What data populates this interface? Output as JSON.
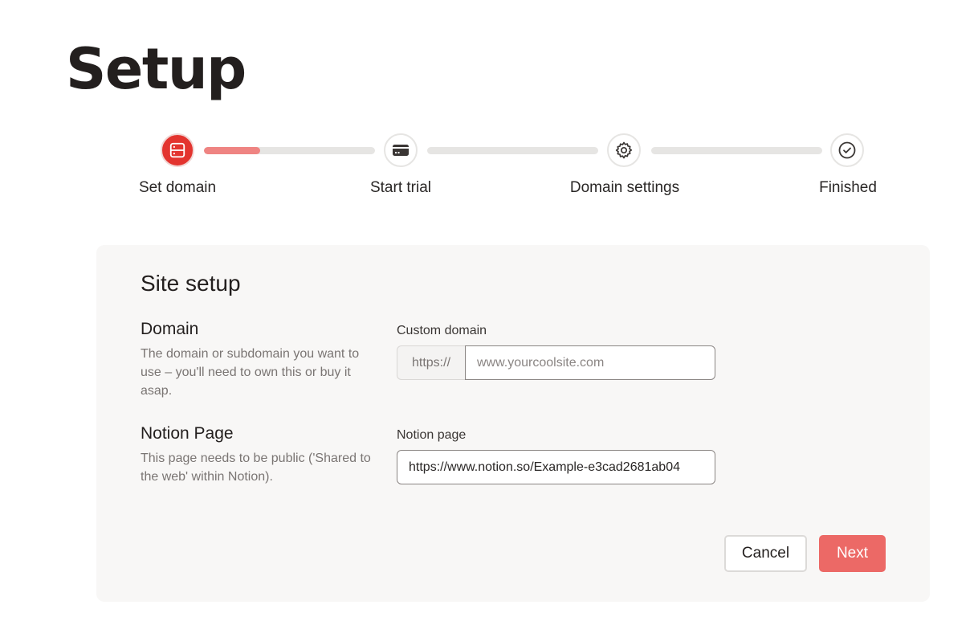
{
  "page": {
    "title": "Setup"
  },
  "stepper": {
    "steps": [
      {
        "label": "Set domain",
        "icon": "server-icon",
        "state": "active"
      },
      {
        "label": "Start trial",
        "icon": "credit-card-icon",
        "state": "pending"
      },
      {
        "label": "Domain settings",
        "icon": "gear-icon",
        "state": "pending"
      },
      {
        "label": "Finished",
        "icon": "check-circle-icon",
        "state": "pending"
      }
    ],
    "connector_progress": [
      0.33,
      0,
      0
    ],
    "colors": {
      "active": "#e3342f",
      "progress": "#ef8482",
      "track": "#e6e5e3"
    }
  },
  "card": {
    "title": "Site setup",
    "domain": {
      "heading": "Domain",
      "description": "The domain or subdomain you want to use – you'll need to own this or buy it asap.",
      "field_label": "Custom domain",
      "prefix": "https://",
      "value": "",
      "placeholder": "www.yourcoolsite.com"
    },
    "notion": {
      "heading": "Notion Page",
      "description": "This page needs to be public ('Shared to the web' within Notion).",
      "field_label": "Notion page",
      "value": "https://www.notion.so/Example-e3cad2681ab04"
    },
    "buttons": {
      "cancel": "Cancel",
      "next": "Next"
    },
    "colors": {
      "next_bg": "#ec6966"
    }
  }
}
